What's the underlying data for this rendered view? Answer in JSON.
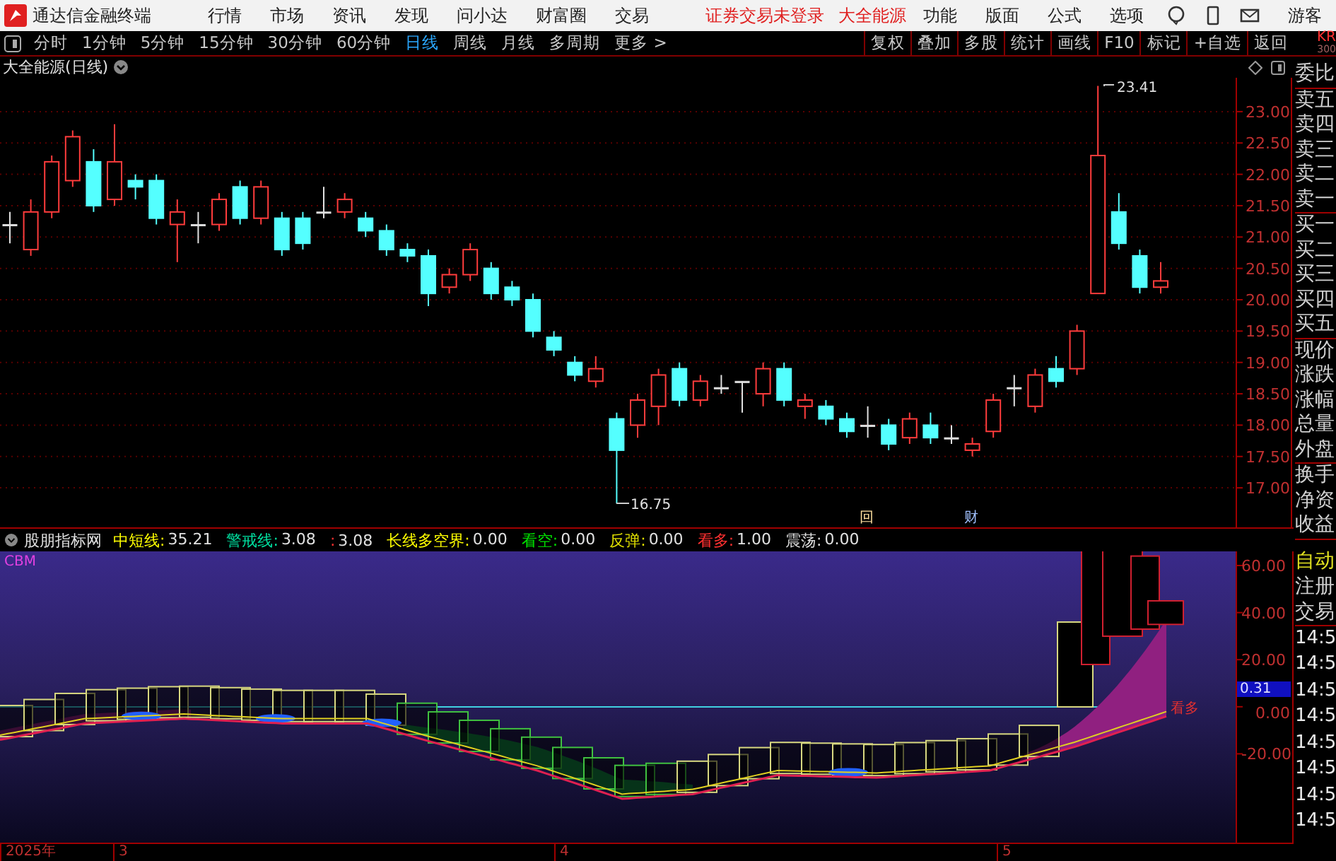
{
  "menu_bar": {
    "app_title": "通达信金融终端",
    "menus": [
      "行情",
      "市场",
      "资讯",
      "发现",
      "问小达",
      "财富圈",
      "交易"
    ],
    "login_status": "证券交易未登录",
    "stock_name": "大全能源",
    "right_menus": [
      "功能",
      "版面",
      "公式",
      "选项"
    ],
    "user": "游客"
  },
  "period_toolbar": {
    "periods": [
      {
        "label": "分时",
        "selected": false
      },
      {
        "label": "1分钟",
        "selected": false
      },
      {
        "label": "5分钟",
        "selected": false
      },
      {
        "label": "15分钟",
        "selected": false
      },
      {
        "label": "30分钟",
        "selected": false
      },
      {
        "label": "60分钟",
        "selected": false
      },
      {
        "label": "日线",
        "selected": true
      },
      {
        "label": "周线",
        "selected": false
      },
      {
        "label": "月线",
        "selected": false
      },
      {
        "label": "多周期",
        "selected": false
      },
      {
        "label": "更多 >",
        "selected": false
      }
    ],
    "actions": [
      "复权",
      "叠加",
      "多股",
      "统计",
      "画线",
      "F10",
      "标记",
      "+自选",
      "返回"
    ],
    "code_fragment": [
      "KR",
      "300"
    ]
  },
  "price_chart": {
    "title": "大全能源(日线)",
    "high_label": "23.41",
    "low_label": "16.75",
    "markers": [
      "回",
      "财"
    ],
    "chart_data": {
      "type": "candlestick",
      "grid": true,
      "ohlc": [
        [
          21.2,
          21.4,
          20.9,
          21.2
        ],
        [
          20.8,
          21.6,
          20.7,
          21.4
        ],
        [
          21.4,
          22.3,
          21.3,
          22.2
        ],
        [
          21.9,
          22.7,
          21.8,
          22.6
        ],
        [
          22.2,
          22.4,
          21.4,
          21.5
        ],
        [
          21.6,
          22.8,
          21.5,
          22.2
        ],
        [
          21.9,
          22.0,
          21.6,
          21.8
        ],
        [
          21.9,
          22.0,
          21.2,
          21.3
        ],
        [
          21.2,
          21.6,
          20.6,
          21.4
        ],
        [
          21.2,
          21.4,
          20.9,
          21.2
        ],
        [
          21.2,
          21.7,
          21.1,
          21.6
        ],
        [
          21.8,
          21.9,
          21.2,
          21.3
        ],
        [
          21.3,
          21.9,
          21.2,
          21.8
        ],
        [
          21.3,
          21.4,
          20.7,
          20.8
        ],
        [
          21.3,
          21.4,
          20.8,
          20.9
        ],
        [
          21.4,
          21.8,
          21.3,
          21.4
        ],
        [
          21.4,
          21.7,
          21.3,
          21.6
        ],
        [
          21.3,
          21.4,
          21.0,
          21.1
        ],
        [
          21.1,
          21.2,
          20.7,
          20.8
        ],
        [
          20.8,
          20.9,
          20.6,
          20.7
        ],
        [
          20.7,
          20.8,
          19.9,
          20.1
        ],
        [
          20.2,
          20.5,
          20.1,
          20.4
        ],
        [
          20.4,
          20.9,
          20.3,
          20.8
        ],
        [
          20.5,
          20.6,
          20.0,
          20.1
        ],
        [
          20.2,
          20.3,
          19.9,
          20.0
        ],
        [
          20.0,
          20.1,
          19.4,
          19.5
        ],
        [
          19.4,
          19.5,
          19.1,
          19.2
        ],
        [
          19.0,
          19.1,
          18.7,
          18.8
        ],
        [
          18.7,
          19.1,
          18.6,
          18.9
        ],
        [
          18.1,
          18.2,
          16.75,
          17.6
        ],
        [
          18.0,
          18.5,
          17.8,
          18.4
        ],
        [
          18.3,
          18.9,
          18.0,
          18.8
        ],
        [
          18.9,
          19.0,
          18.3,
          18.4
        ],
        [
          18.4,
          18.8,
          18.3,
          18.7
        ],
        [
          18.6,
          18.8,
          18.5,
          18.6
        ],
        [
          18.7,
          18.7,
          18.2,
          18.7
        ],
        [
          18.5,
          19.0,
          18.3,
          18.9
        ],
        [
          18.9,
          19.0,
          18.3,
          18.4
        ],
        [
          18.3,
          18.5,
          18.1,
          18.4
        ],
        [
          18.3,
          18.4,
          18.0,
          18.1
        ],
        [
          18.1,
          18.2,
          17.8,
          17.9
        ],
        [
          18.0,
          18.3,
          17.8,
          18.0
        ],
        [
          18.0,
          18.1,
          17.6,
          17.7
        ],
        [
          17.8,
          18.2,
          17.7,
          18.1
        ],
        [
          18.0,
          18.2,
          17.7,
          17.8
        ],
        [
          17.8,
          18.0,
          17.7,
          17.8
        ],
        [
          17.6,
          17.8,
          17.5,
          17.7
        ],
        [
          17.9,
          18.5,
          17.8,
          18.4
        ],
        [
          18.6,
          18.8,
          18.3,
          18.6
        ],
        [
          18.3,
          18.9,
          18.2,
          18.8
        ],
        [
          18.9,
          19.1,
          18.6,
          18.7
        ],
        [
          18.9,
          19.6,
          18.8,
          19.5
        ],
        [
          20.1,
          23.41,
          20.1,
          22.3
        ],
        [
          21.4,
          21.7,
          20.8,
          20.9
        ],
        [
          20.7,
          20.8,
          20.1,
          20.2
        ],
        [
          20.2,
          20.6,
          20.1,
          20.3
        ]
      ],
      "ylim": [
        16.37,
        23.54
      ],
      "yticks": [
        {
          "value": 23,
          "label": "23.00"
        },
        {
          "value": 22.5,
          "label": "22.50"
        },
        {
          "value": 22,
          "label": "22.00"
        },
        {
          "value": 21.5,
          "label": "21.50"
        },
        {
          "value": 21,
          "label": "21.00"
        },
        {
          "value": 20.5,
          "label": "20.50"
        },
        {
          "value": 20,
          "label": "20.00"
        },
        {
          "value": 19.5,
          "label": "19.50"
        },
        {
          "value": 19,
          "label": "19.00"
        },
        {
          "value": 18.5,
          "label": "18.50"
        },
        {
          "value": 18,
          "label": "18.00"
        },
        {
          "value": 17.5,
          "label": "17.50"
        },
        {
          "value": 17,
          "label": "17.00"
        }
      ]
    }
  },
  "indicator": {
    "name": "股朋指标网",
    "values": [
      {
        "label": "中短线:",
        "value": "35.21",
        "kind": "short"
      },
      {
        "label": "警戒线:",
        "value": "3.08",
        "kind": "warn"
      },
      {
        "label": ":",
        "value": "3.08",
        "kind": "bull"
      },
      {
        "label": "长线多空界:",
        "value": "0.00",
        "kind": "long"
      },
      {
        "label": "看空:",
        "value": "0.00",
        "kind": "bear"
      },
      {
        "label": "反弹:",
        "value": "0.00",
        "kind": "rebound"
      },
      {
        "label": "看多:",
        "value": "1.00",
        "kind": "bull"
      },
      {
        "label": "震荡:",
        "value": "0.00",
        "kind": "range"
      }
    ],
    "series_label": "CBM",
    "signal_label": "看多",
    "y_axis": [
      "60.00",
      "40.00",
      "20.00",
      "0.00",
      "-20.00"
    ],
    "current_value": "0.31"
  },
  "date_axis": [
    "2025年",
    "3",
    "4",
    "5"
  ],
  "quote_panel": {
    "field_groups": [
      [
        "委比"
      ],
      [
        "卖五",
        "卖四",
        "卖三",
        "卖二",
        "卖一"
      ],
      [
        "买一",
        "买二",
        "买三",
        "买四",
        "买五"
      ],
      [
        "现价",
        "涨跌",
        "涨幅",
        "总量",
        "外盘"
      ],
      [
        "换手",
        "净资",
        "收益"
      ]
    ],
    "tabs": [
      {
        "label": "自动",
        "selected": true
      },
      {
        "label": "注册",
        "selected": false
      },
      {
        "label": "交易",
        "selected": false
      }
    ],
    "times": [
      "14:5",
      "14:5",
      "14:5",
      "14:5",
      "14:5",
      "14:5",
      "14:5",
      "14:5"
    ]
  }
}
